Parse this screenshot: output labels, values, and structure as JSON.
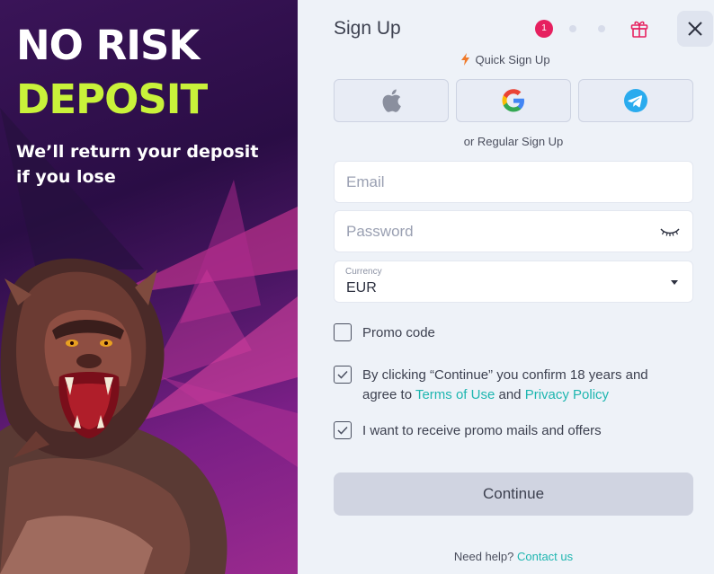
{
  "promo": {
    "title_line1": "NO RISK",
    "title_line2": "DEPOSIT",
    "subtitle": "We’ll return your deposit if you lose",
    "accent_color": "#c9f23a"
  },
  "header": {
    "title": "Sign Up",
    "current_step": "1",
    "close_icon": "close-icon",
    "gift_icon": "gift-icon"
  },
  "quick_signup": {
    "label": "Quick Sign Up",
    "providers": [
      "apple-icon",
      "google-icon",
      "telegram-icon"
    ]
  },
  "regular_signup": {
    "label": "or Regular Sign Up"
  },
  "form": {
    "email_placeholder": "Email",
    "password_placeholder": "Password",
    "currency_label": "Currency",
    "currency_value": "EUR",
    "promo_code_label": "Promo code",
    "promo_code_checked": false,
    "terms_text_before": "By clicking “Continue” you confirm 18 years and agree to ",
    "terms_link": "Terms of Use",
    "terms_and": " and ",
    "privacy_link": "Privacy Policy",
    "terms_checked": true,
    "mails_label": "I want to receive promo mails and offers",
    "mails_checked": true,
    "continue_label": "Continue"
  },
  "footer": {
    "help_text": "Need help?",
    "contact_link": "Contact us"
  },
  "colors": {
    "step_active": "#e6205f",
    "link": "#1fb6b0"
  }
}
